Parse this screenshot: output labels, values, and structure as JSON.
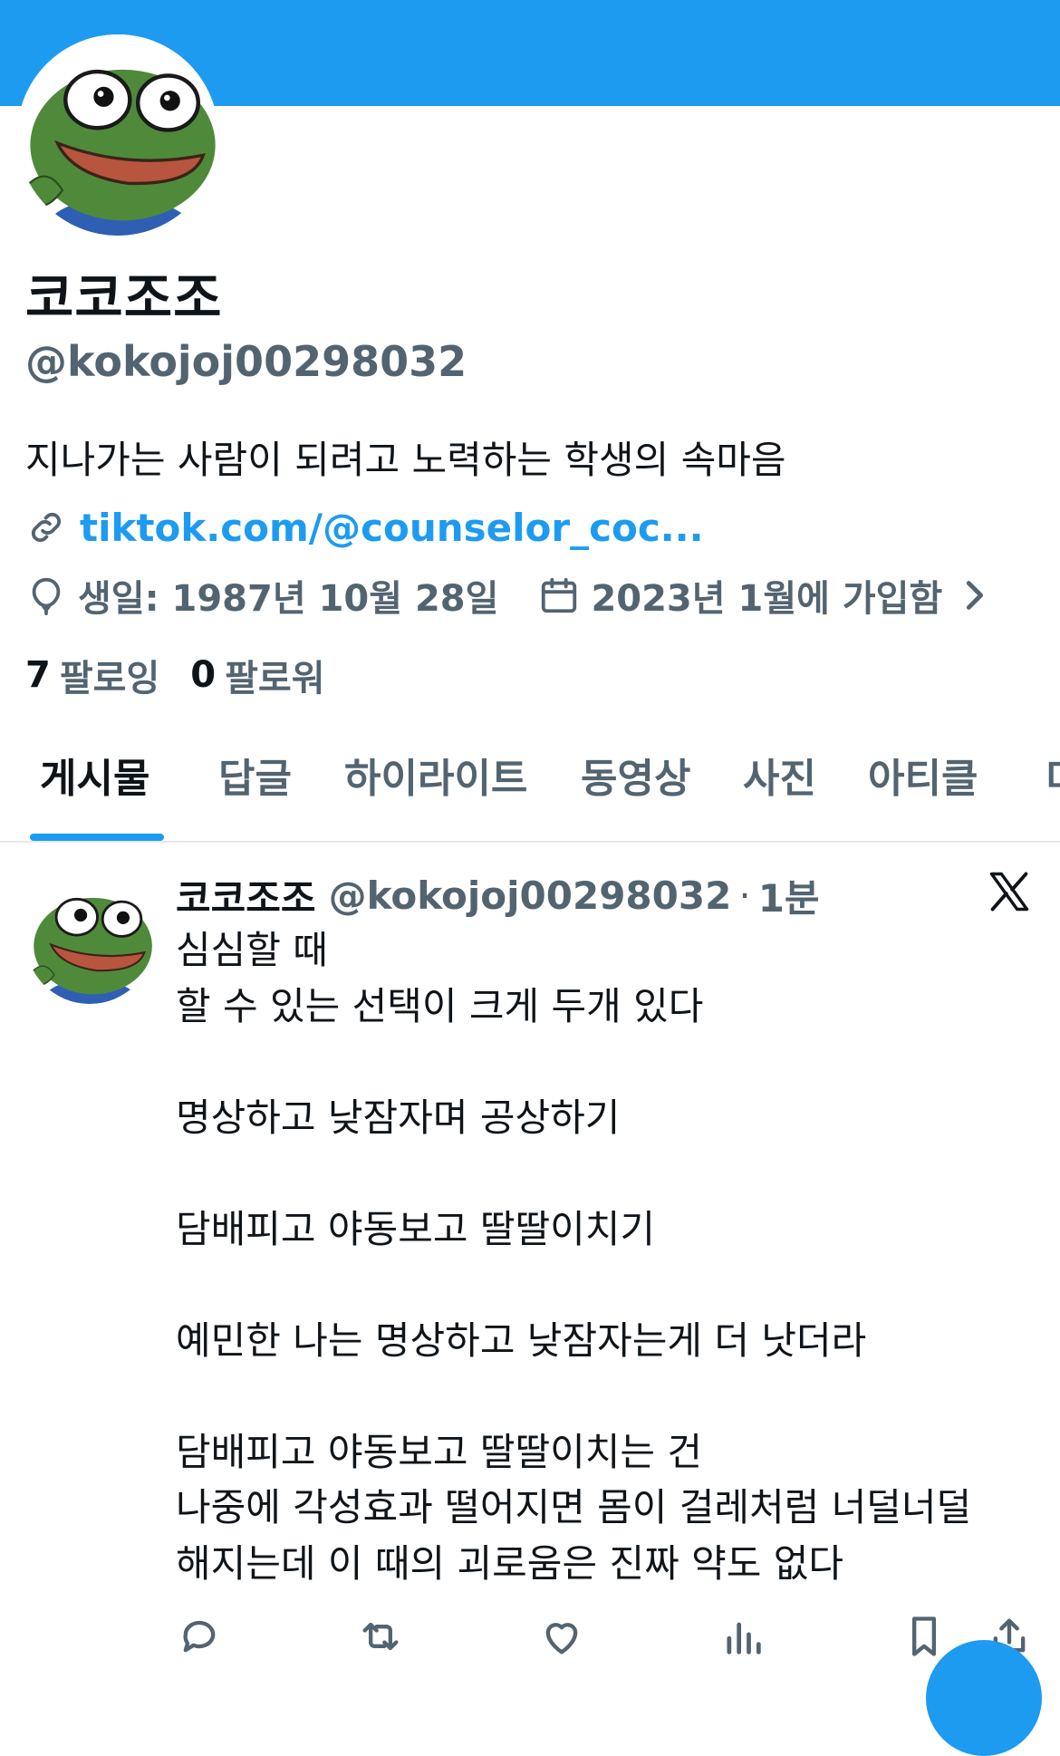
{
  "profile": {
    "name": "코코조조",
    "handle": "@kokojoj00298032",
    "bio": "지나가는 사람이 되려고 노력하는 학생의 속마음",
    "link": "tiktok.com/@counselor_coc...",
    "birthday": "생일: 1987년 10월 28일",
    "joined": "2023년 1월에 가입함",
    "following_count": "7",
    "following_label": "팔로잉",
    "followers_count": "0",
    "followers_label": "팔로워"
  },
  "tabs": [
    "게시물",
    "답글",
    "하이라이트",
    "동영상",
    "사진",
    "아티클",
    "미"
  ],
  "active_tab": "게시물",
  "post": {
    "author_name": "코코조조",
    "author_handle": "@kokojoj00298032",
    "separator": "·",
    "time": "1분",
    "lines": [
      "심심할 때",
      "할 수 있는 선택이 크게 두개 있다",
      "",
      "명상하고 낮잠자며 공상하기",
      "",
      "담배피고 야동보고 딸딸이치기",
      "",
      "예민한 나는 명상하고 낮잠자는게 더 낫더라",
      "",
      "담배피고 야동보고 딸딸이치는 건",
      "나중에 각성효과 떨어지면 몸이 걸레처럼 너덜너덜",
      "해지는데 이 때의 괴로움은 진짜 약도 없다"
    ]
  },
  "icons": {
    "link": "link-icon",
    "birthday": "balloon-icon",
    "joined": "calendar-icon",
    "chevron": "chevron-right-icon",
    "source": "x-logo-icon",
    "actions": [
      "reply-icon",
      "retweet-icon",
      "like-icon",
      "views-icon",
      "bookmark-icon",
      "share-icon"
    ]
  },
  "colors": {
    "accent": "#1d9bf0",
    "text": "#0f1419",
    "secondary": "#536471"
  }
}
